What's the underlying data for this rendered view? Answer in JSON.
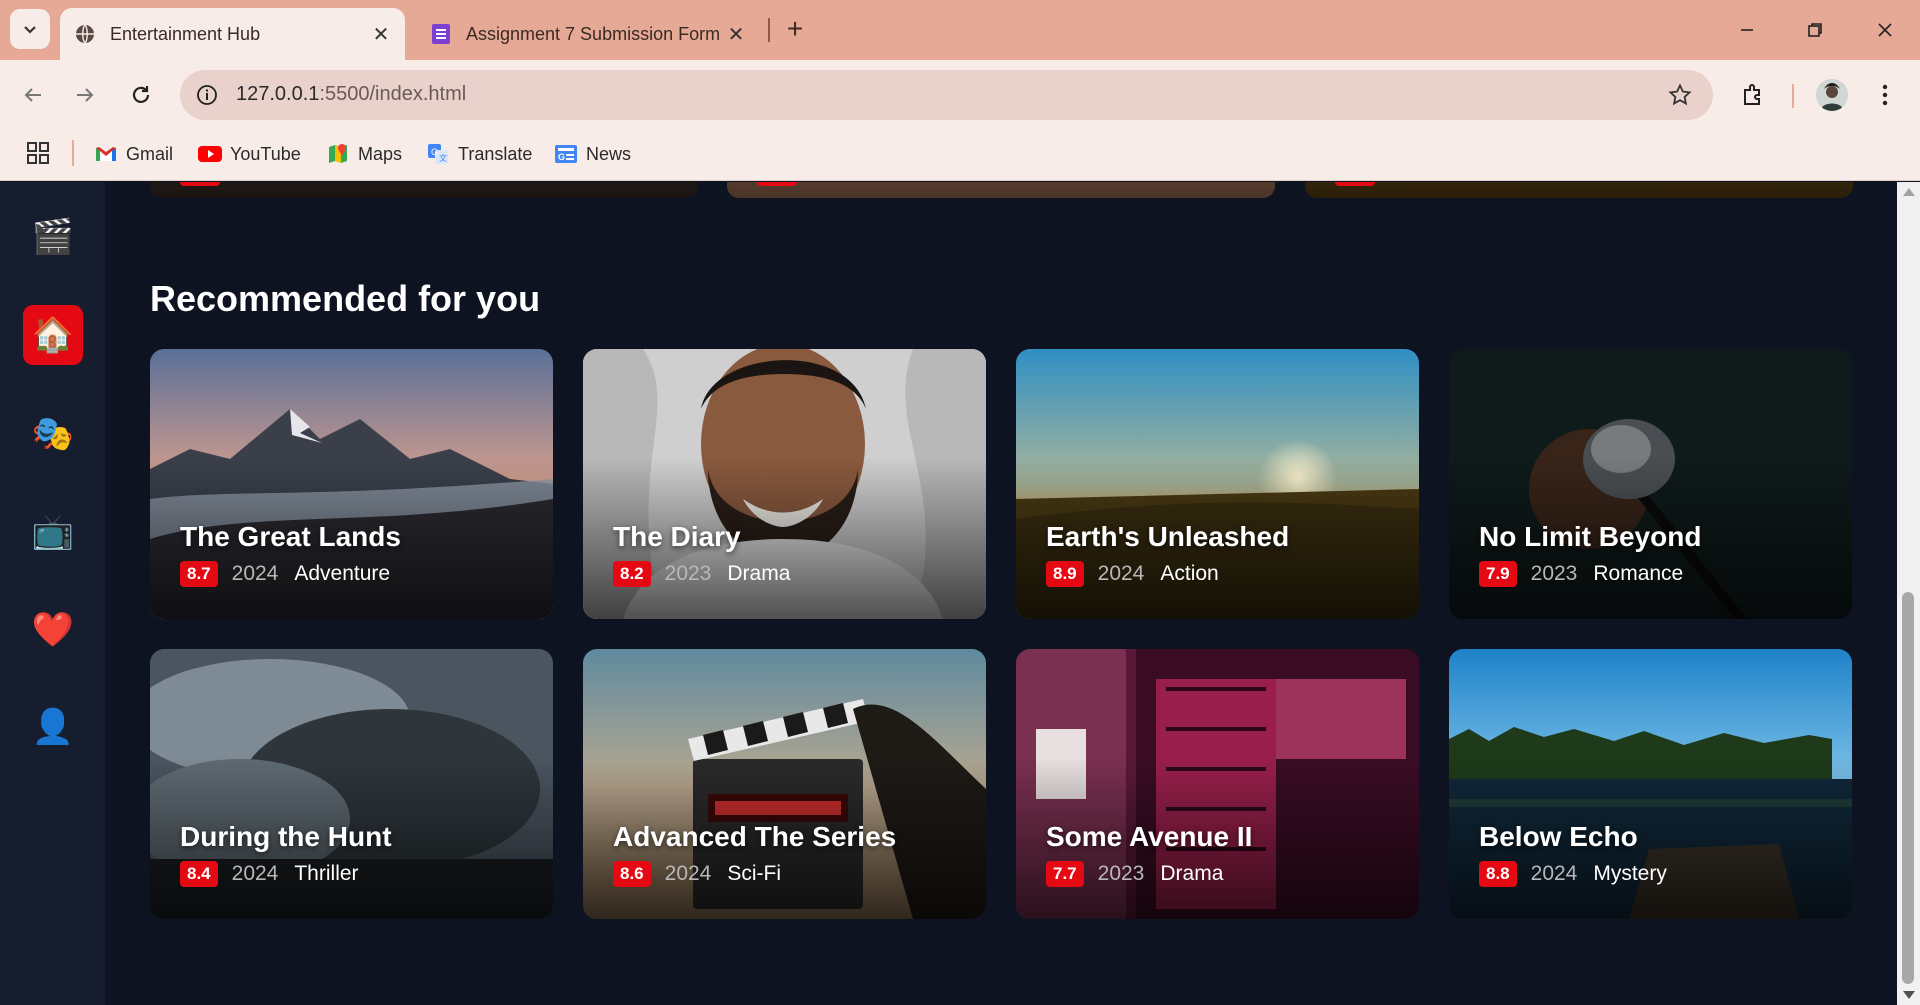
{
  "browser": {
    "tabs": [
      {
        "title": "Entertainment Hub",
        "icon": "globe-icon",
        "active": true
      },
      {
        "title": "Assignment 7 Submission Form",
        "icon": "forms-icon",
        "active": false
      }
    ],
    "url_host": "127.0.0.1",
    "url_path": ":5500/index.html",
    "bookmarks": [
      {
        "label": "Gmail",
        "icon": "gmail-icon"
      },
      {
        "label": "YouTube",
        "icon": "youtube-icon"
      },
      {
        "label": "Maps",
        "icon": "maps-icon"
      },
      {
        "label": "Translate",
        "icon": "translate-icon"
      },
      {
        "label": "News",
        "icon": "news-icon"
      }
    ]
  },
  "sidebar": {
    "items": [
      {
        "name": "movies",
        "glyph": "🎬",
        "active": false
      },
      {
        "name": "home",
        "glyph": "🏠",
        "active": true
      },
      {
        "name": "theater",
        "glyph": "🎭",
        "active": false
      },
      {
        "name": "tv",
        "glyph": "📺",
        "active": false
      },
      {
        "name": "favorites",
        "glyph": "❤️",
        "active": false
      },
      {
        "name": "profile",
        "glyph": "👤",
        "active": false
      }
    ]
  },
  "main": {
    "section_title": "Recommended for you",
    "cards": [
      {
        "title": "The Great Lands",
        "rating": "8.7",
        "year": "2024",
        "genre": "Adventure",
        "art": "mountains"
      },
      {
        "title": "The Diary",
        "rating": "8.2",
        "year": "2023",
        "genre": "Drama",
        "art": "portrait"
      },
      {
        "title": "Earth's Unleashed",
        "rating": "8.9",
        "year": "2024",
        "genre": "Action",
        "art": "sunset-field"
      },
      {
        "title": "No Limit Beyond",
        "rating": "7.9",
        "year": "2023",
        "genre": "Romance",
        "art": "microphone"
      },
      {
        "title": "During the Hunt",
        "rating": "8.4",
        "year": "2024",
        "genre": "Thriller",
        "art": "storm-clouds"
      },
      {
        "title": "Advanced The Series",
        "rating": "8.6",
        "year": "2024",
        "genre": "Sci-Fi",
        "art": "clapperboard"
      },
      {
        "title": "Some Avenue II",
        "rating": "7.7",
        "year": "2023",
        "genre": "Drama",
        "art": "cinema-neon"
      },
      {
        "title": "Below Echo",
        "rating": "8.8",
        "year": "2024",
        "genre": "Mystery",
        "art": "lake-forest"
      }
    ]
  },
  "colors": {
    "accent": "#e50914",
    "background": "#0d1321",
    "sidebar": "#161d2f",
    "tabstrip": "#e5a996",
    "toolbar": "#f8ece8"
  }
}
